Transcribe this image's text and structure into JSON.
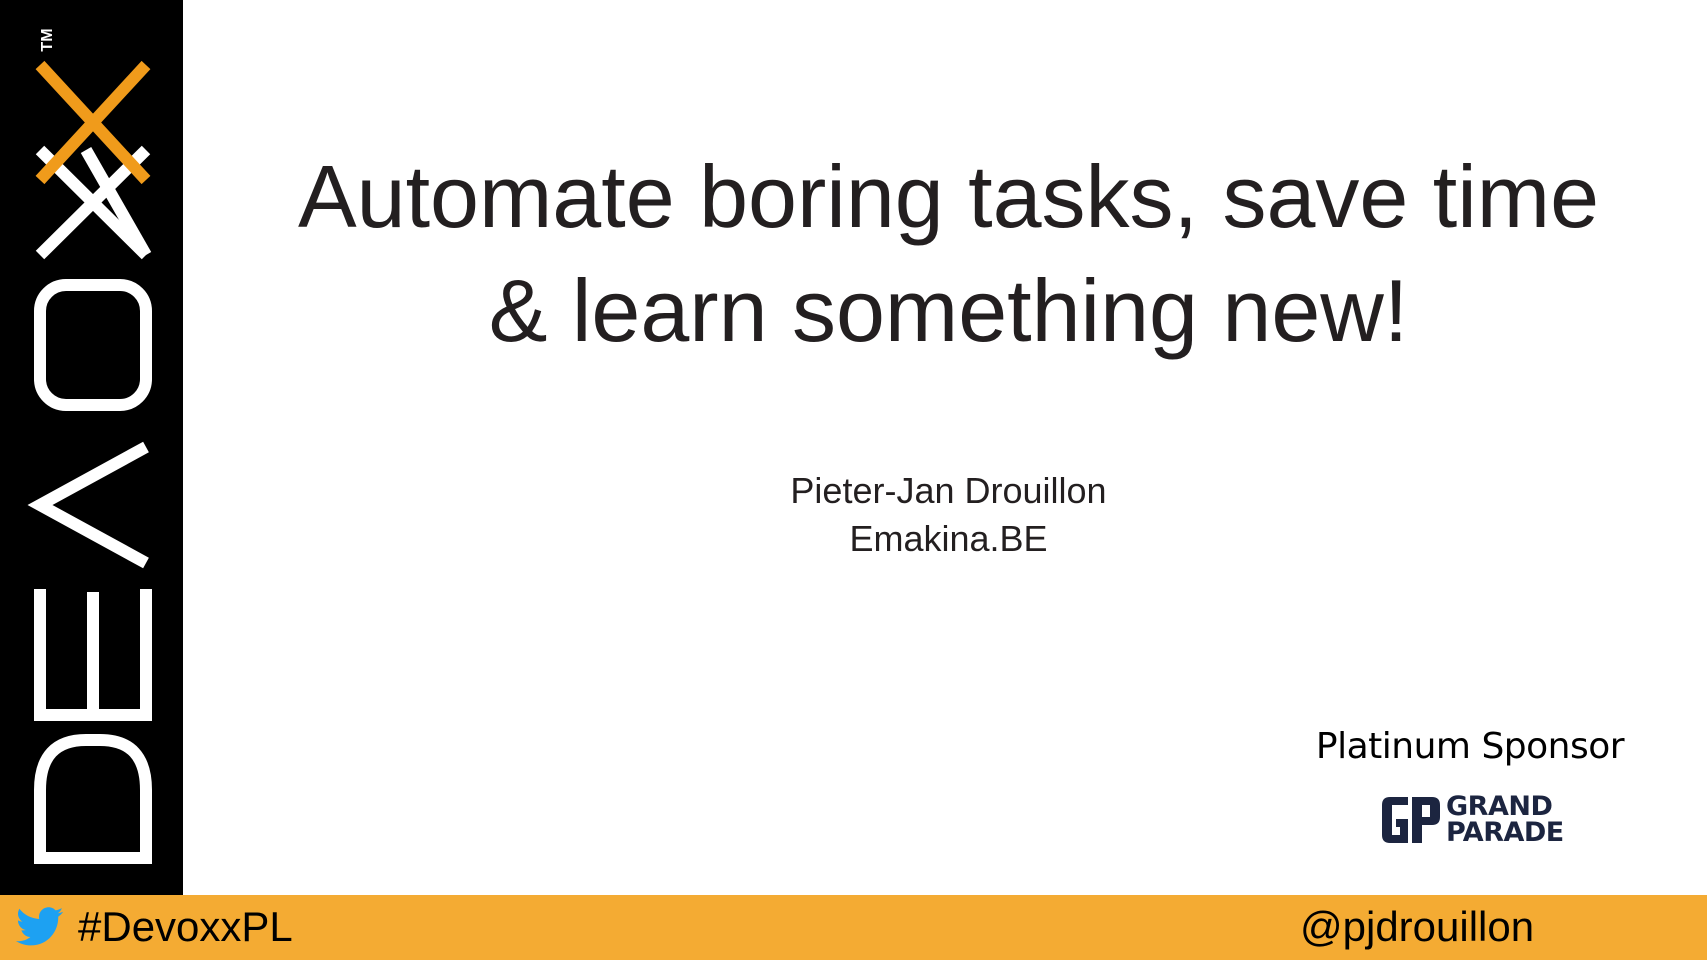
{
  "brand": {
    "name": "DEVOXX",
    "trademark": "TM",
    "colors": {
      "bar": "#000000",
      "letters": "#ffffff",
      "accent": "#f09b1b"
    }
  },
  "title": {
    "line1": "Automate boring tasks, save time",
    "line2": "& learn something new!"
  },
  "speaker": {
    "name": "Pieter-Jan Drouillon",
    "company": "Emakina.BE"
  },
  "sponsor": {
    "label": "Platinum Sponsor",
    "logo_line1": "GRAND",
    "logo_line2": "PARADE",
    "logo_color": "#1c2540"
  },
  "footer": {
    "icon": "twitter-bird-icon",
    "hashtag": "#DevoxxPL",
    "handle": "@pjdrouillon",
    "colors": {
      "bar": "#f4ab33",
      "icon": "#1da1f2"
    }
  }
}
